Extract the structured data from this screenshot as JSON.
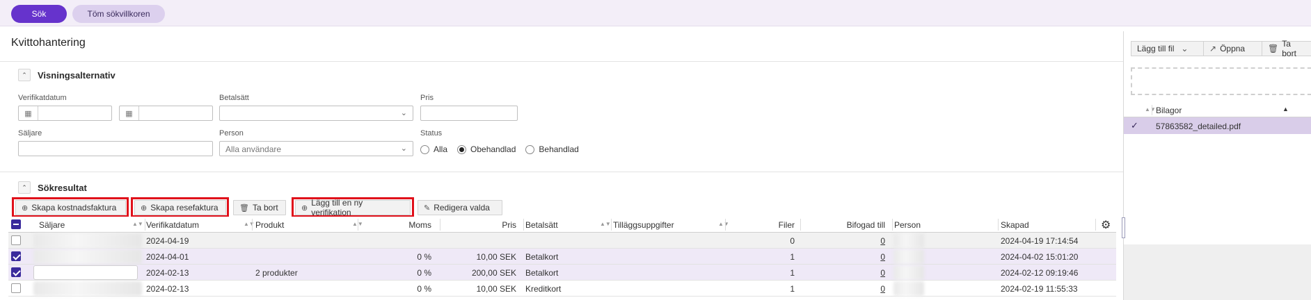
{
  "topbar": {
    "search_label": "Sök",
    "clear_label": "Töm sökvillkoren"
  },
  "page": {
    "title": "Kvittohantering"
  },
  "view_options": {
    "title": "Visningsalternativ",
    "verifikatdatum_label": "Verifikatdatum",
    "betalsatt_label": "Betalsätt",
    "pris_label": "Pris",
    "saljare_label": "Säljare",
    "person_label": "Person",
    "person_value": "Alla användare",
    "status_label": "Status",
    "status_options": [
      "Alla",
      "Obehandlad",
      "Behandlad"
    ],
    "status_selected": "Obehandlad"
  },
  "results": {
    "title": "Sökresultat",
    "toolbar": {
      "create_expense": "Skapa kostnadsfaktura",
      "create_travel": "Skapa resefaktura",
      "delete": "Ta bort",
      "add_verification": "Lägg till en ny verifikation",
      "edit_selected": "Redigera valda"
    },
    "columns": [
      "Säljare",
      "Verifikatdatum",
      "Produkt",
      "Moms",
      "Pris",
      "Betalsätt",
      "Tilläggsuppgifter",
      "Filer",
      "Bifogad till",
      "Person",
      "Skapad"
    ],
    "rows": [
      {
        "checked": false,
        "verifikatdatum": "2024-04-19",
        "produkt": "",
        "moms": "",
        "pris": "",
        "betalsatt": "",
        "tillagg": "",
        "filer": "0",
        "bifogad": "0",
        "skapad": "2024-04-19 17:14:54"
      },
      {
        "checked": true,
        "verifikatdatum": "2024-04-01",
        "produkt": "",
        "moms": "0 %",
        "pris": "10,00 SEK",
        "betalsatt": "Betalkort",
        "tillagg": "",
        "filer": "1",
        "bifogad": "0",
        "skapad": "2024-04-02 15:01:20"
      },
      {
        "checked": true,
        "verifikatdatum": "2024-02-13",
        "produkt": "2 produkter",
        "moms": "0 %",
        "pris": "200,00 SEK",
        "betalsatt": "Betalkort",
        "tillagg": "",
        "filer": "1",
        "bifogad": "0",
        "skapad": "2024-02-12 09:19:46"
      },
      {
        "checked": false,
        "verifikatdatum": "2024-02-13",
        "produkt": "",
        "moms": "0 %",
        "pris": "10,00 SEK",
        "betalsatt": "Kreditkort",
        "tillagg": "",
        "filer": "1",
        "bifogad": "0",
        "skapad": "2024-02-19 11:55:33"
      }
    ]
  },
  "attachments": {
    "add_to_file": "Lägg till fil",
    "open": "Öppna",
    "delete": "Ta bort",
    "column": "Bilagor",
    "files": [
      "57863582_detailed.pdf"
    ]
  },
  "colors": {
    "primary": "#6633cc",
    "secondary": "#dcd0ee",
    "highlight": "#e0101a",
    "checkbox": "#3a2a9c",
    "selected_row": "#d9cde9"
  }
}
